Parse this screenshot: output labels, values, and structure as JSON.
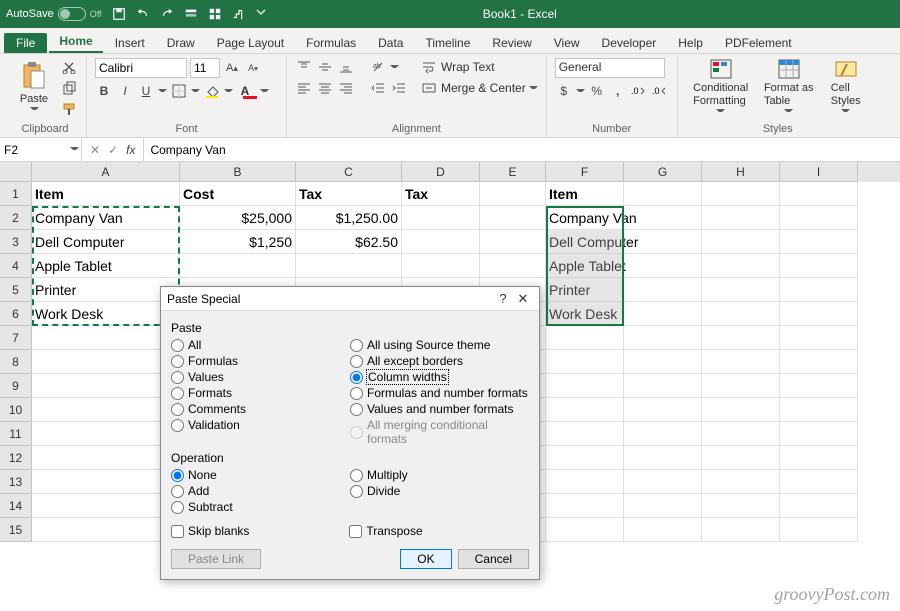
{
  "titlebar": {
    "autosave_label": "AutoSave",
    "autosave_state": "Off",
    "doc_title": "Book1 - Excel"
  },
  "tabs": {
    "file": "File",
    "items": [
      "Home",
      "Insert",
      "Draw",
      "Page Layout",
      "Formulas",
      "Data",
      "Timeline",
      "Review",
      "View",
      "Developer",
      "Help",
      "PDFelement"
    ],
    "active": "Home"
  },
  "ribbon": {
    "clipboard": {
      "label": "Clipboard",
      "paste": "Paste"
    },
    "font": {
      "label": "Font",
      "name": "Calibri",
      "size": "11"
    },
    "alignment": {
      "label": "Alignment",
      "wrap": "Wrap Text",
      "merge": "Merge & Center"
    },
    "number": {
      "label": "Number",
      "format": "General"
    },
    "styles": {
      "label": "Styles",
      "cond": "Conditional\nFormatting",
      "table": "Format as\nTable",
      "cell": "Cell\nStyles"
    }
  },
  "formula": {
    "name_ref": "F2",
    "value": "Company Van"
  },
  "columns": [
    "A",
    "B",
    "C",
    "D",
    "E",
    "F",
    "G",
    "H",
    "I"
  ],
  "sheet": {
    "row1": {
      "A": "Item",
      "B": "Cost",
      "C": "Tax",
      "D": "Tax",
      "F": "Item"
    },
    "row2": {
      "A": "Company Van",
      "B": "$25,000",
      "C": "$1,250.00",
      "F": "Company Van"
    },
    "row3": {
      "A": "Dell Computer",
      "B": "$1,250",
      "C": "$62.50",
      "F": "Dell Computer"
    },
    "row4": {
      "A": "Apple Tablet",
      "F": "Apple Tablet"
    },
    "row5": {
      "A": "Printer",
      "F": "Printer"
    },
    "row6": {
      "A": "Work Desk",
      "F": "Work Desk"
    }
  },
  "dialog": {
    "title": "Paste Special",
    "paste_label": "Paste",
    "paste_left": [
      "All",
      "Formulas",
      "Values",
      "Formats",
      "Comments",
      "Validation"
    ],
    "paste_right": [
      "All using Source theme",
      "All except borders",
      "Column widths",
      "Formulas and number formats",
      "Values and number formats",
      "All merging conditional formats"
    ],
    "selected": "Column widths",
    "operation_label": "Operation",
    "op_left": [
      "None",
      "Add",
      "Subtract"
    ],
    "op_right": [
      "Multiply",
      "Divide"
    ],
    "op_selected": "None",
    "skip": "Skip blanks",
    "transpose": "Transpose",
    "paste_link": "Paste Link",
    "ok": "OK",
    "cancel": "Cancel"
  },
  "watermark": "groovyPost.com"
}
